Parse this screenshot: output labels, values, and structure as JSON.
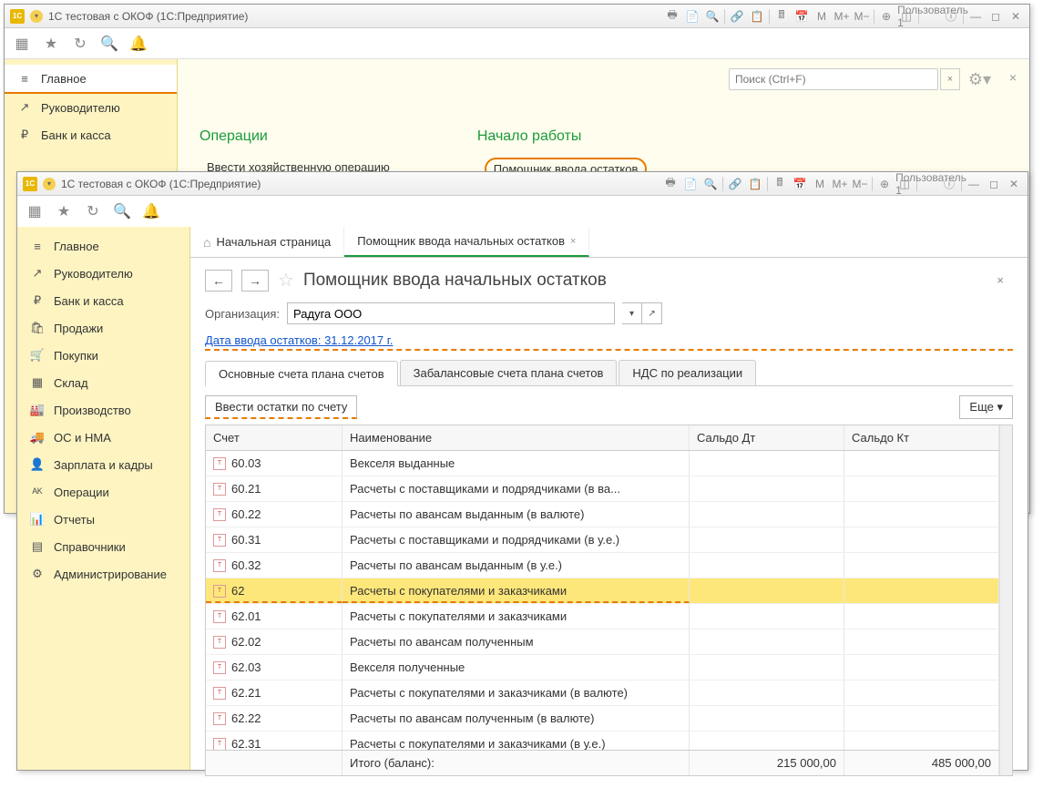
{
  "titlebar_text": "1С тестовая с ОКОФ  (1С:Предприятие)",
  "user_label": "Пользователь 1",
  "toolbar_labels": {
    "m": "M",
    "m_plus": "M+",
    "m_minus": "M−"
  },
  "search_placeholder": "Поиск (Ctrl+F)",
  "sidebar1": [
    {
      "icon": "≡",
      "label": "Главное",
      "active": true
    },
    {
      "icon": "↗",
      "label": "Руководителю"
    },
    {
      "icon": "₽",
      "label": "Банк и касса"
    }
  ],
  "content1": {
    "heads": [
      "Операции",
      "Начало работы"
    ],
    "link1": "Ввести хозяйственную операцию",
    "link2": "Помощник ввода остатков"
  },
  "sidebar2": [
    {
      "icon": "≡",
      "label": "Главное"
    },
    {
      "icon": "↗",
      "label": "Руководителю"
    },
    {
      "icon": "₽",
      "label": "Банк и касса"
    },
    {
      "icon": "🛍",
      "label": "Продажи"
    },
    {
      "icon": "🛒",
      "label": "Покупки"
    },
    {
      "icon": "▦",
      "label": "Склад"
    },
    {
      "icon": "🏭",
      "label": "Производство"
    },
    {
      "icon": "🚚",
      "label": "ОС и НМА"
    },
    {
      "icon": "👤",
      "label": "Зарплата и кадры"
    },
    {
      "icon": "ᴬᴷ",
      "label": "Операции"
    },
    {
      "icon": "📊",
      "label": "Отчеты"
    },
    {
      "icon": "▤",
      "label": "Справочники"
    },
    {
      "icon": "⚙",
      "label": "Администрирование"
    }
  ],
  "tabs2": {
    "home": "Начальная страница",
    "active": "Помощник ввода начальных остатков"
  },
  "page": {
    "title": "Помощник ввода начальных остатков",
    "org_label": "Организация:",
    "org_value": "Радуга ООО",
    "date_link": "Дата ввода остатков: 31.12.2017 г.",
    "inner_tabs": [
      "Основные счета плана счетов",
      "Забалансовые счета плана счетов",
      "НДС по реализации"
    ],
    "enter_button": "Ввести остатки по счету",
    "more_button": "Еще ▾",
    "grid_headers": [
      "Счет",
      "Наименование",
      "Сальдо Дт",
      "Сальдо Кт"
    ],
    "rows": [
      {
        "acct": "60.03",
        "name": "Векселя выданные",
        "dt": "",
        "kt": ""
      },
      {
        "acct": "60.21",
        "name": "Расчеты с поставщиками и подрядчиками (в ва...",
        "dt": "",
        "kt": ""
      },
      {
        "acct": "60.22",
        "name": "Расчеты по авансам выданным (в валюте)",
        "dt": "",
        "kt": ""
      },
      {
        "acct": "60.31",
        "name": "Расчеты с поставщиками и подрядчиками (в у.е.)",
        "dt": "",
        "kt": ""
      },
      {
        "acct": "60.32",
        "name": "Расчеты по авансам выданным (в у.е.)",
        "dt": "",
        "kt": ""
      },
      {
        "acct": "62",
        "name": "Расчеты с покупателями и заказчиками",
        "dt": "",
        "kt": "",
        "selected": true
      },
      {
        "acct": "62.01",
        "name": "Расчеты с покупателями и заказчиками",
        "dt": "",
        "kt": ""
      },
      {
        "acct": "62.02",
        "name": "Расчеты по авансам полученным",
        "dt": "",
        "kt": ""
      },
      {
        "acct": "62.03",
        "name": "Векселя полученные",
        "dt": "",
        "kt": ""
      },
      {
        "acct": "62.21",
        "name": "Расчеты с покупателями и заказчиками (в валюте)",
        "dt": "",
        "kt": ""
      },
      {
        "acct": "62.22",
        "name": "Расчеты по авансам полученным (в валюте)",
        "dt": "",
        "kt": ""
      },
      {
        "acct": "62.31",
        "name": "Расчеты с покупателями и заказчиками (в у.е.)",
        "dt": "",
        "kt": ""
      }
    ],
    "footer": {
      "label": "Итого (баланс):",
      "dt": "215 000,00",
      "kt": "485 000,00"
    }
  }
}
